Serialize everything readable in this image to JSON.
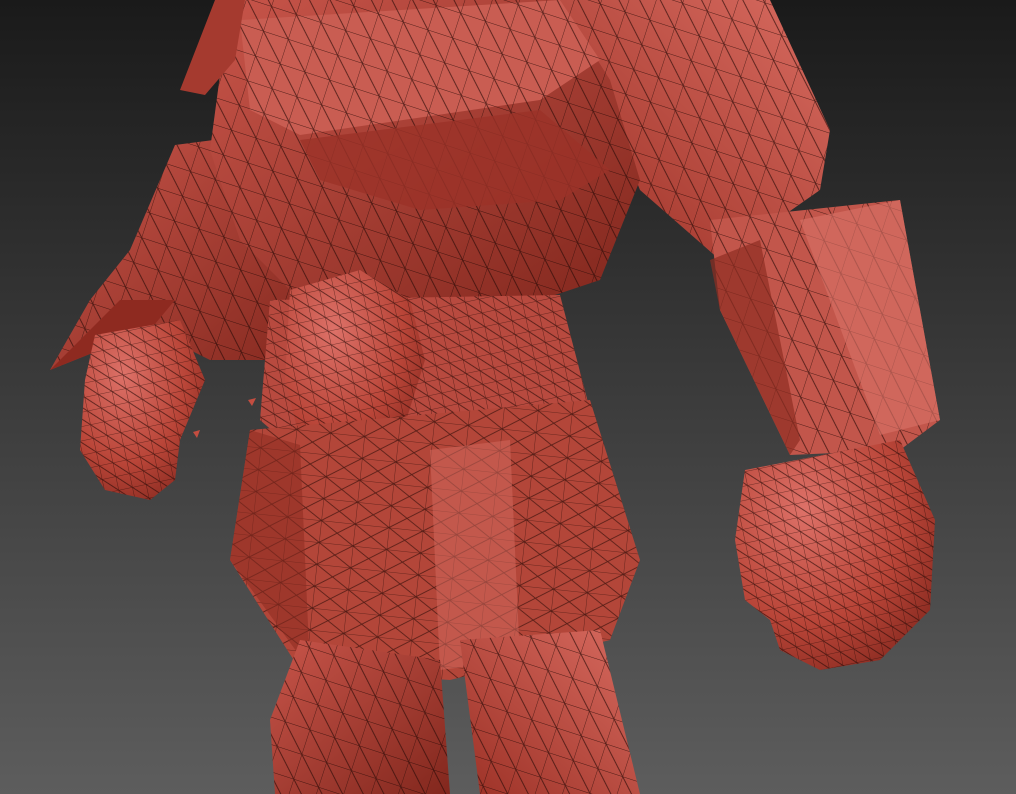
{
  "viewport": {
    "background_top": "#1a1a1a",
    "background_bottom": "#5d5d5d",
    "mesh_base_color": "#b94538",
    "mesh_light_color": "#dd7168",
    "mesh_dark_color": "#6e1d15",
    "wire_color": "#2a0a06",
    "display_mode": "polyframe"
  }
}
